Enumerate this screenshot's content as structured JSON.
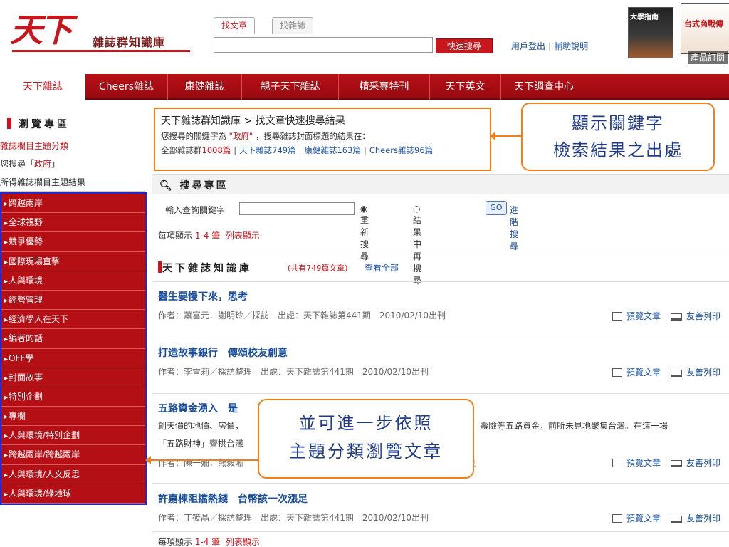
{
  "header": {
    "logo_main": "天下",
    "logo_sub": "雜誌群知識庫",
    "tabs": [
      "找文章",
      "找雜誌"
    ],
    "quick_search_label": "快速搜尋",
    "user_login": "用戶登出",
    "help": "輔助說明",
    "product_label": "產品訂閱",
    "cover1_text": "大學指南",
    "cover2_text": "台式商戰傳"
  },
  "nav": {
    "items": [
      "天下雜誌",
      "Cheers雜誌",
      "康健雜誌",
      "親子天下雜誌",
      "精采專特刊",
      "天下英文",
      "天下調查中心"
    ]
  },
  "sidebar": {
    "browse_title": "瀏覽專區",
    "category_label": "雜誌欄目主題分類",
    "search_prefix": "您搜尋「",
    "search_keyword": "政府",
    "search_suffix": "」",
    "result_label": "所得雜誌欄目主題結果",
    "categories": [
      "跨越兩岸",
      "全球視野",
      "競爭優勢",
      "國際現場直擊",
      "人與環境",
      "經營管理",
      "經濟學人在天下",
      "編者的話",
      "OFF學",
      "封面故事",
      "特別企劃",
      "專欄",
      "人與環境/特別企劃",
      "跨越兩岸/跨越兩岸",
      "人與環境/人文反思",
      "人與環境/綠地球"
    ]
  },
  "info": {
    "title": "天下雜誌群知識庫 > 找文章快速搜尋結果",
    "line1_a": "您搜尋的關鍵字為 ",
    "line1_kw": "\"政府\"",
    "line1_b": " ，搜尋雜誌封面標題的結果在：",
    "all_label": "全部雜誌群",
    "all_count": "1008篇",
    "cw_link": "天下雜誌749篇",
    "health_link": "康健雜誌163篇",
    "cheers_link": "Cheers雜誌96篇"
  },
  "callout1": {
    "line1": "顯示關鍵字",
    "line2": "檢索結果之出處"
  },
  "callout2": {
    "line1": "並可進一步依照",
    "line2": "主題分類瀏覽文章"
  },
  "search_area": {
    "title": "搜尋專區",
    "query_label": "輸入查詢關鍵字",
    "radio_new": "重新搜尋",
    "radio_within": "結果中再搜尋",
    "go_label": "GO",
    "advanced": "進階搜尋"
  },
  "paging": {
    "per_page_prefix": "每項顯示 ",
    "per_page_range": "1-4 筆",
    "list_view": "列表顯示"
  },
  "library": {
    "title": "天下雜誌知識庫",
    "count": "(共有749篇文章)",
    "view_all": "查看全部"
  },
  "articles": [
    {
      "title": "醫生要慢下來，思考",
      "meta": "作者：蕭富元．謝明玲／採訪　出處：天下雜誌第441期　2010/02/10出刊",
      "desc": ""
    },
    {
      "title": "打造故事銀行　傳頌校友創意",
      "meta": "作者：李雪莉／採訪整理　出處：天下雜誌第441期　2010/02/10出刊",
      "desc": ""
    },
    {
      "title": "五路資金湧入　是",
      "meta": "作者：陳一姍．熊毅晰",
      "meta_tail": "出刊",
      "desc1": "創天價的地價、房價，",
      "desc1_tail": "陸資、壽險等五路資金，前所未見地聚集台灣。在這一場",
      "desc2": "「五路財神」齊拱台灣"
    },
    {
      "title": "許嘉棟阻擋熱錢　台幣該一次漲足",
      "meta": "作者：丁筱晶／採訪整理　出處：天下雜誌第441期　2010/02/10出刊",
      "desc": ""
    }
  ],
  "actions": {
    "preview": "預覽文章",
    "print": "友善列印"
  },
  "colors": {
    "brand_red": "#c8161d",
    "link_blue": "#1a4fa0",
    "callout_orange": "#f07f1a",
    "highlight_border_blue": "#1c2bd8"
  }
}
